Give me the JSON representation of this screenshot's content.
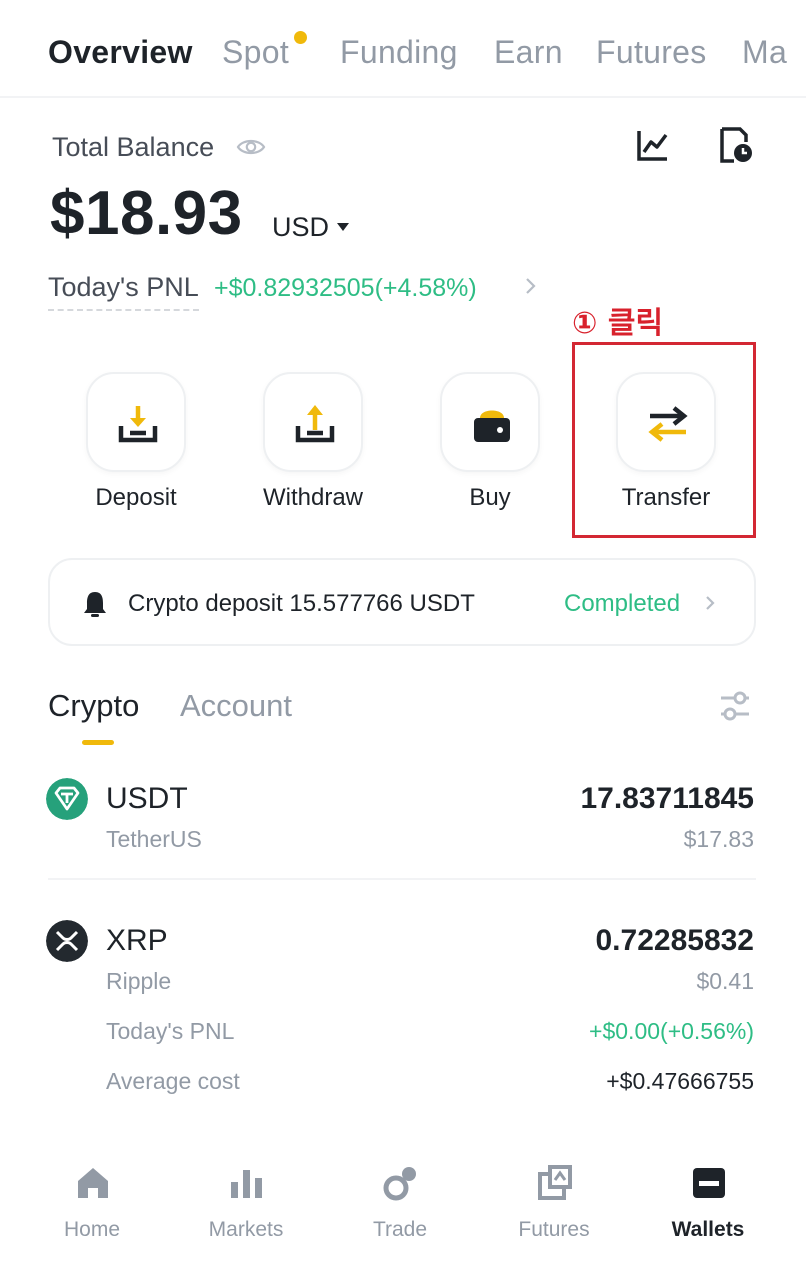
{
  "top_tabs": [
    {
      "label": "Overview",
      "active": true
    },
    {
      "label": "Spot",
      "active": false
    },
    {
      "label": "Funding",
      "active": false
    },
    {
      "label": "Earn",
      "active": false
    },
    {
      "label": "Futures",
      "active": false
    },
    {
      "label": "Ma",
      "active": false
    }
  ],
  "balance": {
    "label": "Total Balance",
    "value": "$18.93",
    "currency": "USD",
    "pnl_label": "Today's PNL",
    "pnl_value": "+$0.82932505(+4.58%)"
  },
  "annotation": {
    "label": "① 클릭",
    "color": "#d32733"
  },
  "actions": [
    {
      "label": "Deposit",
      "icon": "deposit-icon"
    },
    {
      "label": "Withdraw",
      "icon": "withdraw-icon"
    },
    {
      "label": "Buy",
      "icon": "wallet-buy-icon"
    },
    {
      "label": "Transfer",
      "icon": "transfer-icon"
    }
  ],
  "notice": {
    "text": "Crypto deposit 15.577766 USDT",
    "status": "Completed"
  },
  "asset_tabs": [
    {
      "label": "Crypto",
      "active": true
    },
    {
      "label": "Account",
      "active": false
    }
  ],
  "assets": [
    {
      "symbol": "USDT",
      "name": "TetherUS",
      "amount": "17.83711845",
      "usd": "$17.83",
      "icon": "tether-icon",
      "icon_color": "#26a17b"
    },
    {
      "symbol": "XRP",
      "name": "Ripple",
      "amount": "0.72285832",
      "usd": "$0.41",
      "icon": "xrp-icon",
      "icon_color": "#23292f",
      "pnl_label": "Today's PNL",
      "pnl_value": "+$0.00(+0.56%)",
      "avg_label": "Average cost",
      "avg_value": "+$0.47666755"
    }
  ],
  "bottom_nav": [
    {
      "label": "Home",
      "icon": "home-icon",
      "active": false
    },
    {
      "label": "Markets",
      "icon": "markets-icon",
      "active": false
    },
    {
      "label": "Trade",
      "icon": "trade-icon",
      "active": false
    },
    {
      "label": "Futures",
      "icon": "futures-icon",
      "active": false
    },
    {
      "label": "Wallets",
      "icon": "wallet-icon",
      "active": true
    }
  ],
  "colors": {
    "brand": "#f0b90b",
    "positive": "#2ebd85",
    "text": "#1e2329",
    "muted": "#929aa5"
  }
}
